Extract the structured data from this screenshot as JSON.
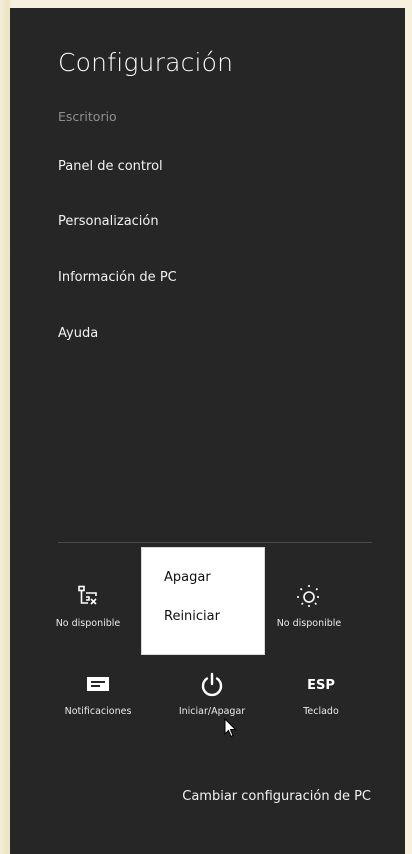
{
  "panel": {
    "title": "Configuración",
    "subtitle": "Escritorio",
    "items": [
      {
        "label": "Panel de control"
      },
      {
        "label": "Personalización"
      },
      {
        "label": "Información de PC"
      },
      {
        "label": "Ayuda"
      }
    ]
  },
  "tiles_row1": {
    "network": {
      "label": "No disponible",
      "icon": "network-unavailable-icon"
    },
    "brightness": {
      "label": "No disponible",
      "icon": "brightness-icon"
    }
  },
  "tiles_row2": {
    "notifications": {
      "label": "Notificaciones",
      "icon": "notifications-icon"
    },
    "power": {
      "label": "Iniciar/Apagar",
      "icon": "power-icon"
    },
    "keyboard": {
      "label": "Teclado",
      "icon_text": "ESP"
    }
  },
  "power_menu": {
    "items": [
      {
        "label": "Apagar"
      },
      {
        "label": "Reiniciar"
      }
    ]
  },
  "footer": {
    "change_settings": "Cambiar configuración de PC"
  },
  "colors": {
    "panel_bg": "#262626",
    "desktop_bg": "#efe9cf",
    "popup_bg": "#ffffff"
  }
}
